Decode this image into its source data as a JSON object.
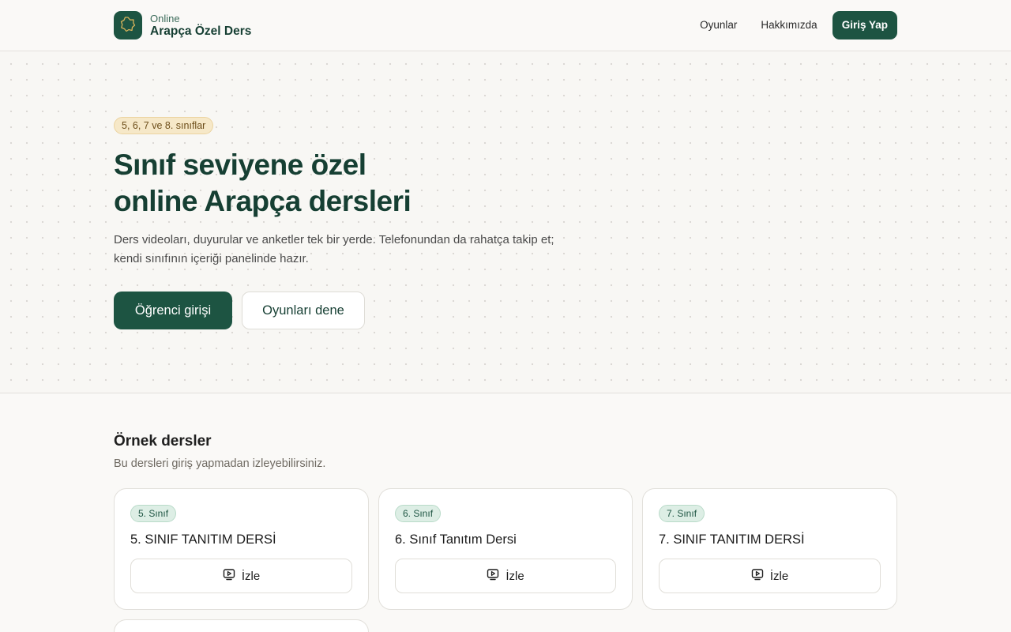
{
  "header": {
    "brand_small": "Online",
    "brand_big": "Arapça Özel Ders",
    "logo_icon": "octagon-star-icon",
    "nav": [
      "Oyunlar",
      "Hakkımızda"
    ],
    "login_button": "Giriş Yap"
  },
  "hero": {
    "badge": "5, 6, 7 ve 8. sınıflar",
    "title_line1": "Sınıf seviyene özel",
    "title_line2": "online Arapça dersleri",
    "desc_line1": "Ders videoları, duyurular ve anketler tek bir yerde. Telefonundan da rahatça takip et;",
    "desc_line2": "kendi sınıfının içeriği panelinde hazır.",
    "primary_button": "Öğrenci girişi",
    "secondary_button": "Oyunları dene"
  },
  "lessons": {
    "title": "Örnek dersler",
    "subtitle": "Bu dersleri giriş yapmadan izleyebilirsiniz.",
    "watch_icon": "video-play-icon",
    "cards": [
      {
        "grade": "5. Sınıf",
        "title": "5. SINIF TANITIM DERSİ",
        "button": "İzle"
      },
      {
        "grade": "6. Sınıf",
        "title": "6. Sınıf Tanıtım Dersi",
        "button": "İzle"
      },
      {
        "grade": "7. Sınıf",
        "title": "7. SINIF TANITIM DERSİ",
        "button": "İzle"
      }
    ]
  },
  "colors": {
    "primary": "#1d5442",
    "background": "#faf9f7",
    "badge_amber": "#f6e8c8",
    "badge_green": "#ddeee5"
  }
}
